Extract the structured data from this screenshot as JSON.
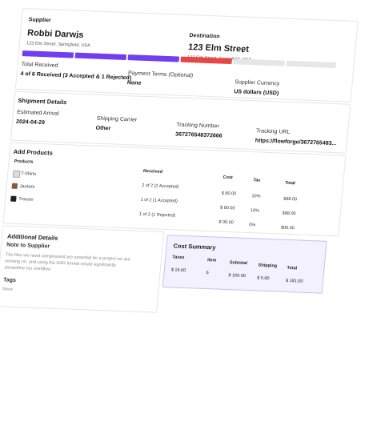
{
  "supplier": {
    "heading": "Supplier",
    "name": "Robbi Darwis",
    "address": "123 Elm Street, Springfield, USA"
  },
  "destination": {
    "heading": "Destination",
    "name": "123 Elm Street",
    "address": "123 Elm Street, Springfield, USA"
  },
  "progress": {
    "segments": [
      {
        "status": "accepted",
        "color": "#6f3ff0"
      },
      {
        "status": "accepted",
        "color": "#6f3ff0"
      },
      {
        "status": "accepted",
        "color": "#6f3ff0"
      },
      {
        "status": "rejected",
        "color": "#e84545"
      },
      {
        "status": "pending",
        "color": "#e6e6e6"
      },
      {
        "status": "pending",
        "color": "#e6e6e6"
      }
    ]
  },
  "summary": {
    "total_received_label": "Total Received",
    "total_received_value": "4 of 6 Received (3 Accepted & 1 Rejected)",
    "payment_terms_label": "Payment Terms (Optional)",
    "payment_terms_value": "None",
    "currency_label": "Supplier Currency",
    "currency_value": "US dollars (USD)"
  },
  "shipping": {
    "heading": "Shipment Details",
    "arrival_label": "Estimated Arrival",
    "arrival_value": "2024-04-29",
    "carrier_label": "Shipping Carrier",
    "carrier_value": "Other",
    "tracking_label": "Tracking Number",
    "tracking_value": "367276548372666",
    "url_label": "Tracking URL",
    "url_value": "https://flowforge/3672765483..."
  },
  "products": {
    "heading": "Add Products",
    "columns": {
      "product": "Products",
      "received": "Received",
      "cost": "Cost",
      "tax": "Tax",
      "total": "Total"
    },
    "rows": [
      {
        "name": "T-Shirts",
        "received": "2 of 2 (2 Accepted)",
        "cost": "$ 80.00",
        "tax": "10%",
        "total": "$88.00",
        "thumb": "#dcdcdc"
      },
      {
        "name": "Jackets",
        "received": "1 of 2 (1 Accepted)",
        "cost": "$ 80.00",
        "tax": "10%",
        "total": "$88.00",
        "thumb": "#8a5a3c"
      },
      {
        "name": "Trouser",
        "received": "1 of 2 (1 Rejected)",
        "cost": "$ 00.00",
        "tax": "0%",
        "total": "$00.00",
        "thumb": "#222222"
      }
    ]
  },
  "additional": {
    "heading": "Additional Details",
    "note_label": "Note to Supplier",
    "note_text_1": "The files we need compressed are essential for a project we are",
    "note_text_2": "working on, and using the RAR format would significantly",
    "note_text_3": "streamline our workflow",
    "tags_label": "Tags",
    "tags_value": "None"
  },
  "cost_summary": {
    "heading": "Cost Summary",
    "columns": {
      "taxes": "Taxes",
      "item": "Item",
      "subtotal": "Subtotal",
      "shipping": "Shipping",
      "total": "Total"
    },
    "values": {
      "taxes": "$ 16.00",
      "item": "6",
      "subtotal": "$ 160.00",
      "shipping": "$ 5.00",
      "total": "$ 181.00"
    },
    "bg": "#f3f1fd",
    "border": "#c9c0f0"
  }
}
